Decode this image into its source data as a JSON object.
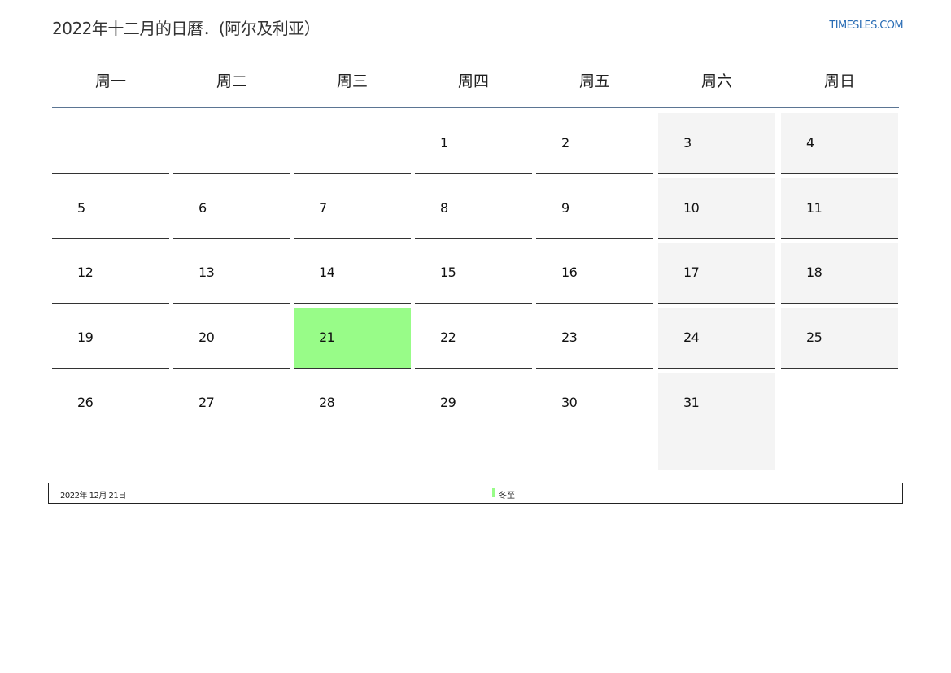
{
  "header": {
    "title": "2022年十二月的日曆．(阿尔及利亚）",
    "brand": "TIMESLES.COM"
  },
  "calendar": {
    "weekdays": [
      "周一",
      "周二",
      "周三",
      "周四",
      "周五",
      "周六",
      "周日"
    ],
    "weeks": [
      [
        "",
        "",
        "",
        "1",
        "2",
        "3",
        "4"
      ],
      [
        "5",
        "6",
        "7",
        "8",
        "9",
        "10",
        "11"
      ],
      [
        "12",
        "13",
        "14",
        "15",
        "16",
        "17",
        "18"
      ],
      [
        "19",
        "20",
        "21",
        "22",
        "23",
        "24",
        "25"
      ],
      [
        "26",
        "27",
        "28",
        "29",
        "30",
        "31",
        ""
      ]
    ],
    "highlighted_day": "21"
  },
  "legend": {
    "date": "2022年 12月 21日",
    "holiday_name": "冬至"
  },
  "colors": {
    "holiday": "#98fc88",
    "weekend": "#f4f4f4",
    "accent_line": "#5b7593",
    "brand": "#2a6db5"
  }
}
